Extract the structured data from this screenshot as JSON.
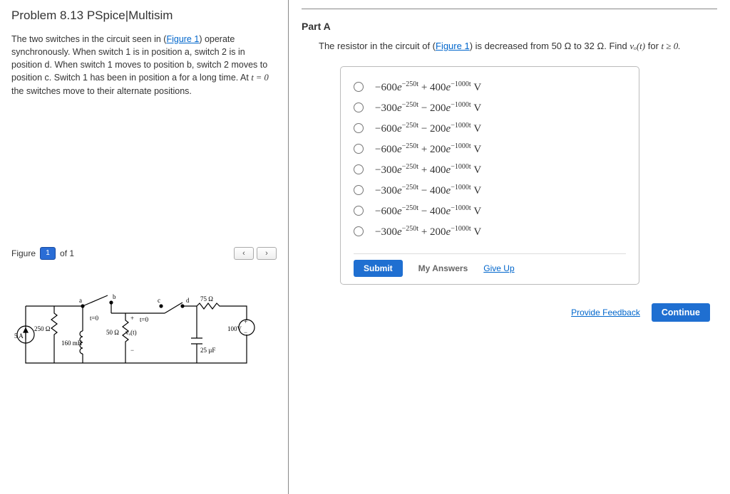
{
  "problem": {
    "title": "Problem 8.13 PSpice|Multisim",
    "desc_pre": "The two switches in the circuit seen in (",
    "desc_figlink": "Figure 1",
    "desc_post": ") operate synchronously. When switch 1 is in position a, switch 2 is in position d. When switch 1 moves to position b, switch 2 moves to position c. Switch 1 has been in position a for a long time. At ",
    "desc_t": "t = 0",
    "desc_end": " the switches move to their alternate positions."
  },
  "figure": {
    "label": "Figure",
    "num": "1",
    "of": "of 1"
  },
  "circuit": {
    "I": "5 A",
    "R1": "250 Ω",
    "L": "160 mH",
    "R2": "50 Ω",
    "vo": "vₒ(t)",
    "R3": "75 Ω",
    "C": "25 µF",
    "V": "100V",
    "t0a": "t=0",
    "t0b": "t=0",
    "a": "a",
    "b": "b",
    "c": "c",
    "d": "d",
    "plus": "+",
    "minus": "−"
  },
  "partA": {
    "label": "Part A",
    "text_pre": "The resistor in the circuit of (",
    "text_figlink": "Figure 1",
    "text_mid": ") is decreased from 50 Ω to 32 Ω. Find ",
    "text_vo": "vₒ(t)",
    "text_for": " for ",
    "text_cond": "t ≥ 0."
  },
  "options": [
    {
      "a": "−600",
      "e1": "−250t",
      "op": " + ",
      "b": "400",
      "e2": "−1000t"
    },
    {
      "a": "−300",
      "e1": "−250t",
      "op": " − ",
      "b": "200",
      "e2": "−1000t"
    },
    {
      "a": "−600",
      "e1": "−250t",
      "op": " − ",
      "b": "200",
      "e2": "−1000t"
    },
    {
      "a": "−600",
      "e1": "−250t",
      "op": " + ",
      "b": "200",
      "e2": "−1000t"
    },
    {
      "a": "−300",
      "e1": "−250t",
      "op": " + ",
      "b": "400",
      "e2": "−1000t"
    },
    {
      "a": "−300",
      "e1": "−250t",
      "op": " − ",
      "b": "400",
      "e2": "−1000t"
    },
    {
      "a": "−600",
      "e1": "−250t",
      "op": " − ",
      "b": "400",
      "e2": "−1000t"
    },
    {
      "a": "−300",
      "e1": "−250t",
      "op": " + ",
      "b": "200",
      "e2": "−1000t"
    }
  ],
  "actions": {
    "submit": "Submit",
    "my_answers": "My Answers",
    "give_up": "Give Up",
    "feedback": "Provide Feedback",
    "continue": "Continue"
  }
}
